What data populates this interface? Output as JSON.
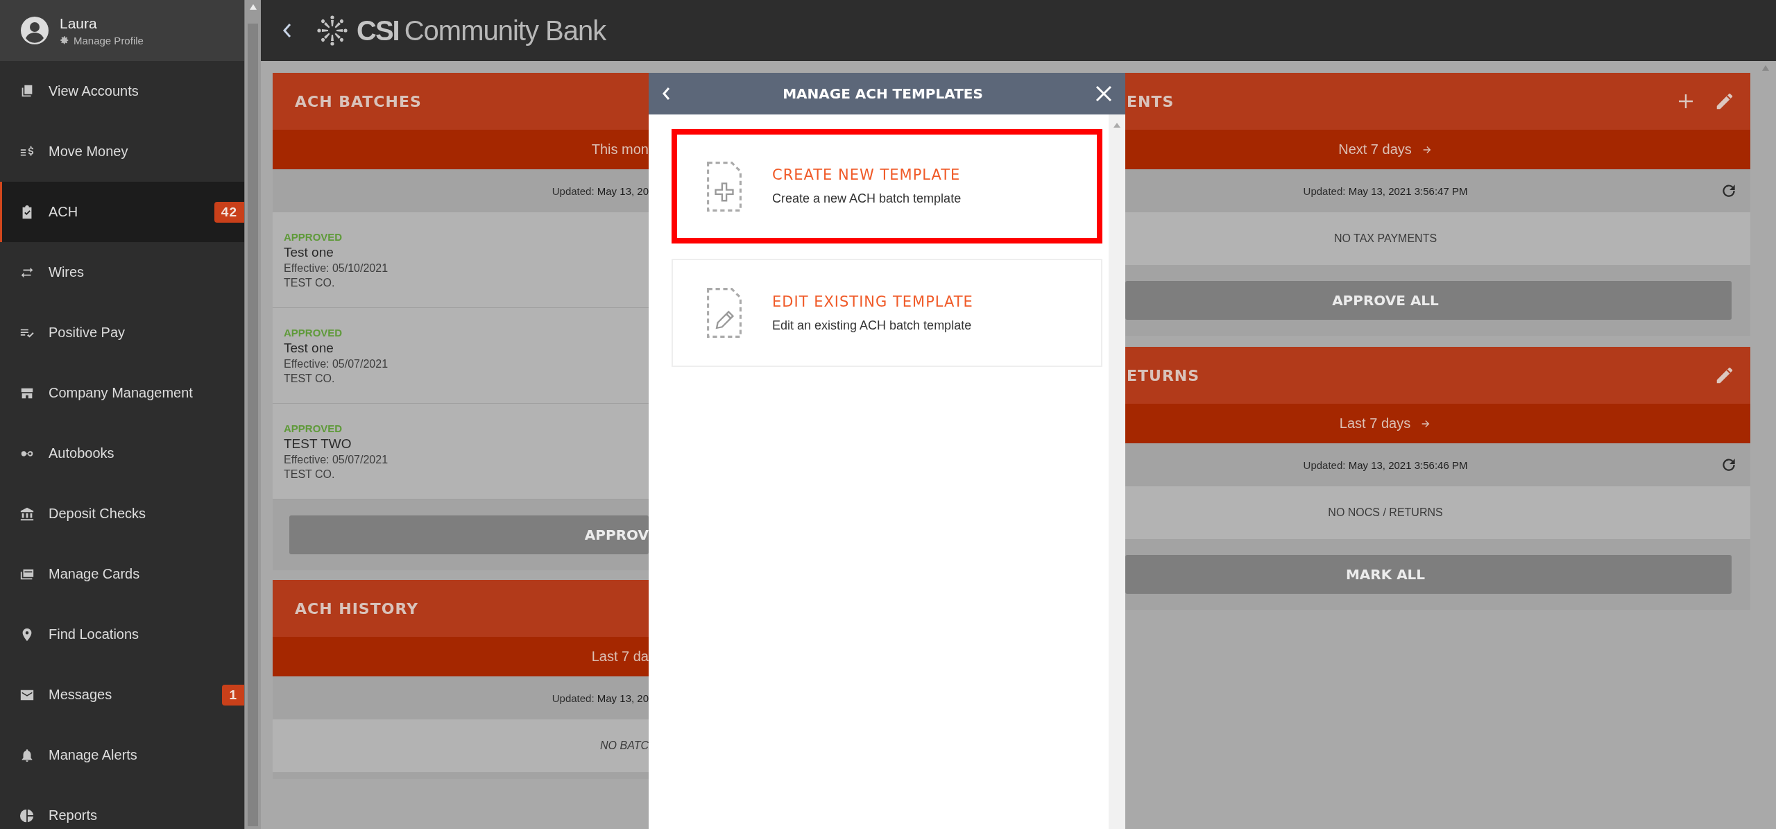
{
  "sidebar": {
    "user": {
      "name": "Laura",
      "link": "Manage Profile"
    },
    "items": [
      {
        "label": "View Accounts",
        "selected": false
      },
      {
        "label": "Move Money",
        "selected": false
      },
      {
        "label": "ACH",
        "selected": true,
        "badge": "42"
      },
      {
        "label": "Wires",
        "selected": false
      },
      {
        "label": "Positive Pay",
        "selected": false
      },
      {
        "label": "Company Management",
        "selected": false
      },
      {
        "label": "Autobooks",
        "selected": false
      },
      {
        "label": "Deposit Checks",
        "selected": false
      },
      {
        "label": "Manage Cards",
        "selected": false
      },
      {
        "label": "Find Locations",
        "selected": false
      },
      {
        "label": "Messages",
        "selected": false,
        "badge": "1"
      },
      {
        "label": "Manage Alerts",
        "selected": false
      },
      {
        "label": "Reports",
        "selected": false
      }
    ]
  },
  "header": {
    "logo_strong": "CSI",
    "logo_rest": "Community Bank"
  },
  "left_panels": [
    {
      "title": "ACH BATCHES",
      "period": "This mon",
      "updated_label": "Updated:",
      "updated_value": "May 13, 20",
      "rows": [
        {
          "status": "APPROVED",
          "name": "Test one",
          "effective": "Effective: 05/10/2021",
          "company": "TEST CO."
        },
        {
          "status": "APPROVED",
          "name": "Test one",
          "effective": "Effective: 05/07/2021",
          "company": "TEST CO."
        },
        {
          "status": "APPROVED",
          "name": "TEST TWO",
          "effective": "Effective: 05/07/2021",
          "company": "TEST CO."
        }
      ],
      "button": "APPROV"
    },
    {
      "title": "ACH HISTORY",
      "period": "Last 7 da",
      "updated_label": "Updated:",
      "updated_value": "May 13, 20",
      "empty": "NO BATC"
    }
  ],
  "right_panels": [
    {
      "title": "ENTS",
      "actions": [
        {
          "kind": "add"
        },
        {
          "kind": "edit"
        }
      ],
      "period": "Next 7 days",
      "updated_label": "Updated:",
      "updated_value": "May 13, 2021 3:56:47 PM",
      "empty": "NO TAX PAYMENTS",
      "button": "APPROVE ALL"
    },
    {
      "title": "ETURNS",
      "actions": [
        {
          "kind": "edit"
        }
      ],
      "period": "Last 7 days",
      "updated_label": "Updated:",
      "updated_value": "May 13, 2021 3:56:46 PM",
      "empty": "NO NOCS / RETURNS",
      "button": "MARK ALL"
    }
  ],
  "modal": {
    "title": "MANAGE ACH TEMPLATES",
    "options": [
      {
        "kind": "create",
        "title": "CREATE NEW TEMPLATE",
        "description": "Create a new ACH batch template",
        "selected": true
      },
      {
        "kind": "edit",
        "title": "EDIT EXISTING TEMPLATE",
        "description": "Edit an existing ACH batch template",
        "selected": false
      }
    ]
  }
}
